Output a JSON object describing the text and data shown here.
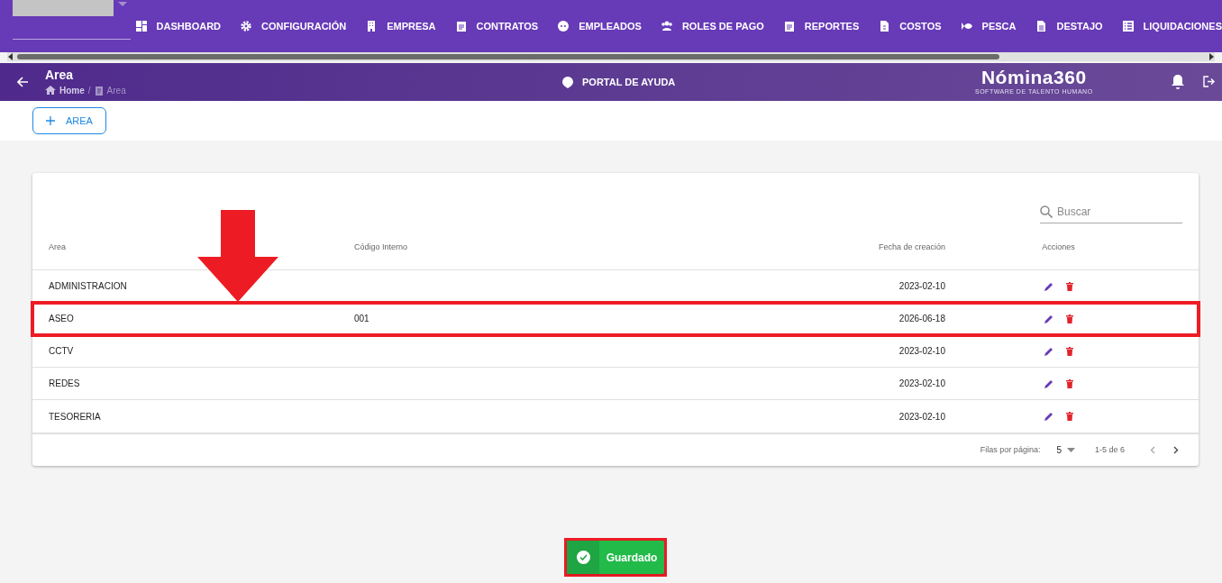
{
  "nav": {
    "menu": [
      {
        "label": "DASHBOARD"
      },
      {
        "label": "CONFIGURACIÓN"
      },
      {
        "label": "EMPRESA"
      },
      {
        "label": "CONTRATOS"
      },
      {
        "label": "EMPLEADOS"
      },
      {
        "label": "ROLES DE PAGO"
      },
      {
        "label": "REPORTES"
      },
      {
        "label": "COSTOS"
      },
      {
        "label": "PESCA"
      },
      {
        "label": "DESTAJO"
      },
      {
        "label": "LIQUIDACIONES"
      }
    ]
  },
  "header": {
    "title": "Area",
    "breadcrumb": [
      "Home",
      "Area"
    ],
    "breadcrumb_separator": "/",
    "help": "PORTAL DE AYUDA",
    "logo": "Nómina360",
    "logo_tagline": "SOFTWARE DE TALENTO HUMANO"
  },
  "toolbar": {
    "add_button": "AREA"
  },
  "table": {
    "search": {
      "placeholder": "Buscar"
    },
    "columns": [
      "Area",
      "Código Interno",
      "Fecha de creación",
      "Acciones"
    ],
    "rows": [
      {
        "area": "ADMINISTRACION",
        "code": "",
        "date": "2023-02-10",
        "annotated": false
      },
      {
        "area": "ASEO",
        "code": "001",
        "date": "2026-06-18",
        "annotated": true
      },
      {
        "area": "CCTV",
        "code": "",
        "date": "2023-02-10",
        "annotated": false
      },
      {
        "area": "REDES",
        "code": "",
        "date": "2023-02-10",
        "annotated": false
      },
      {
        "area": "TESORERIA",
        "code": "",
        "date": "2023-02-10",
        "annotated": false
      }
    ],
    "pagination": {
      "rows_label": "Filas por página:",
      "rows_value": "5",
      "range": "1-5 de 6"
    }
  },
  "toast": {
    "message": "Guardado",
    "annotated": true
  }
}
